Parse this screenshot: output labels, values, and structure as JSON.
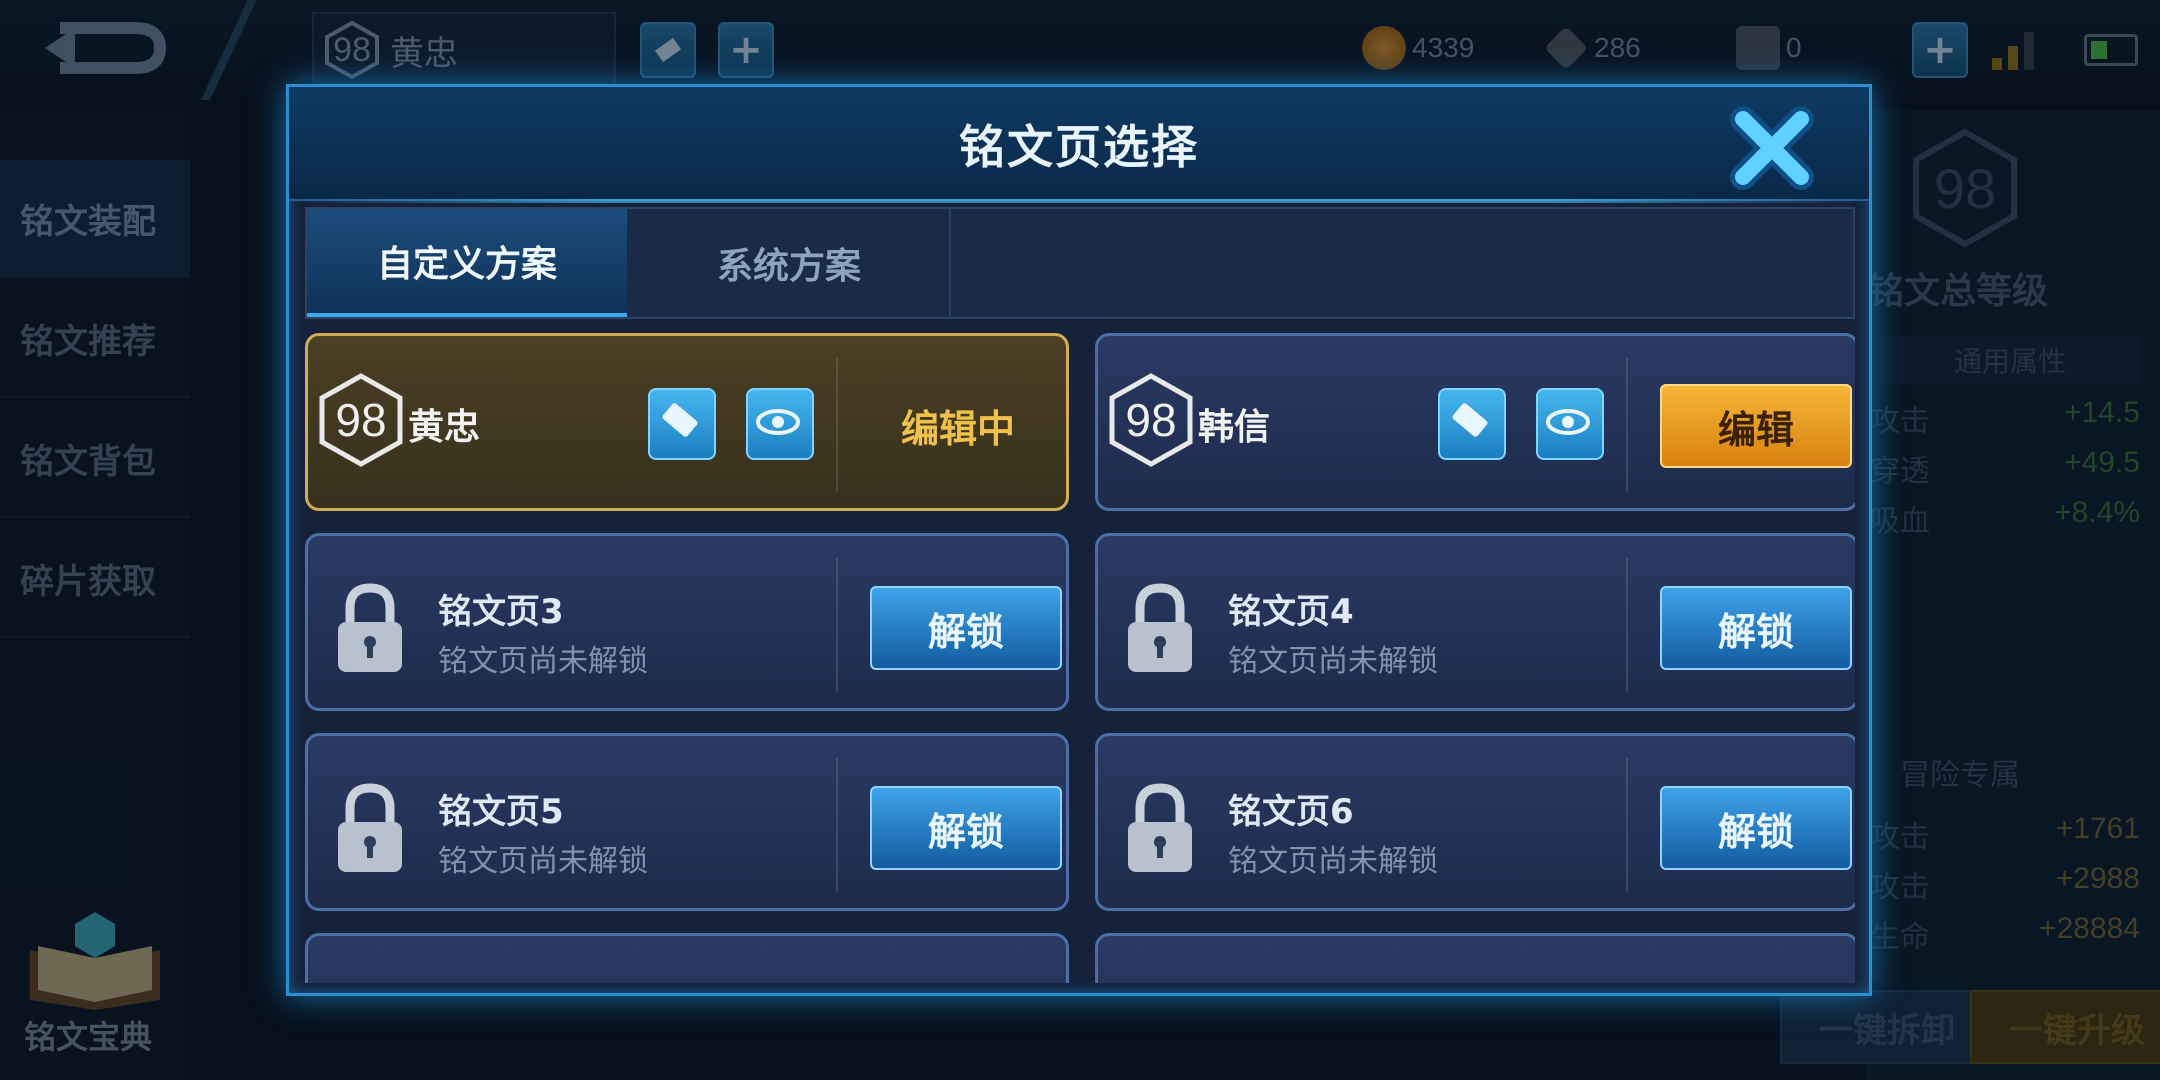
{
  "topbar": {
    "hero_level": "98",
    "hero_name": "黄忠",
    "currencies": [
      {
        "icon": "gold-coin-icon",
        "value": "4339"
      },
      {
        "icon": "diamond-icon",
        "value": "286"
      },
      {
        "icon": "crystal-icon",
        "value": "0"
      }
    ]
  },
  "sidebar": {
    "items": [
      {
        "label": "铭文装配"
      },
      {
        "label": "铭文推荐"
      },
      {
        "label": "铭文背包"
      },
      {
        "label": "碎片获取"
      }
    ],
    "book_label": "铭文宝典"
  },
  "right_panel": {
    "level": "98",
    "title": "铭文总等级",
    "band_label": "通用属性",
    "general_stats": [
      {
        "label": "攻击",
        "value": "+14.5"
      },
      {
        "label": "穿透",
        "value": "+49.5"
      },
      {
        "label": "吸血",
        "value": "+8.4%"
      }
    ],
    "adventure_label": "冒险专属",
    "adventure_stats": [
      {
        "label": "攻击",
        "value": "+1761"
      },
      {
        "label": "攻击",
        "value": "+2988"
      },
      {
        "label": "生命",
        "value": "+28884"
      }
    ],
    "dismantle_label": "一键拆卸",
    "upgrade_label": "一键升级"
  },
  "dialog": {
    "title": "铭文页选择",
    "tabs": [
      {
        "label": "自定义方案"
      },
      {
        "label": "系统方案"
      }
    ],
    "pages": [
      {
        "level": "98",
        "name": "黄忠",
        "status": "编辑中"
      },
      {
        "level": "98",
        "name": "韩信",
        "action": "编辑"
      },
      {
        "title": "铭文页3",
        "subtitle": "铭文页尚未解锁",
        "action": "解锁"
      },
      {
        "title": "铭文页4",
        "subtitle": "铭文页尚未解锁",
        "action": "解锁"
      },
      {
        "title": "铭文页5",
        "subtitle": "铭文页尚未解锁",
        "action": "解锁"
      },
      {
        "title": "铭文页6",
        "subtitle": "铭文页尚未解锁",
        "action": "解锁"
      }
    ]
  },
  "colors": {
    "accent_blue": "#2a8fd0",
    "gold": "#f0c14a",
    "orange_button": "#e89a20",
    "stat_green": "#3b7a3b"
  }
}
